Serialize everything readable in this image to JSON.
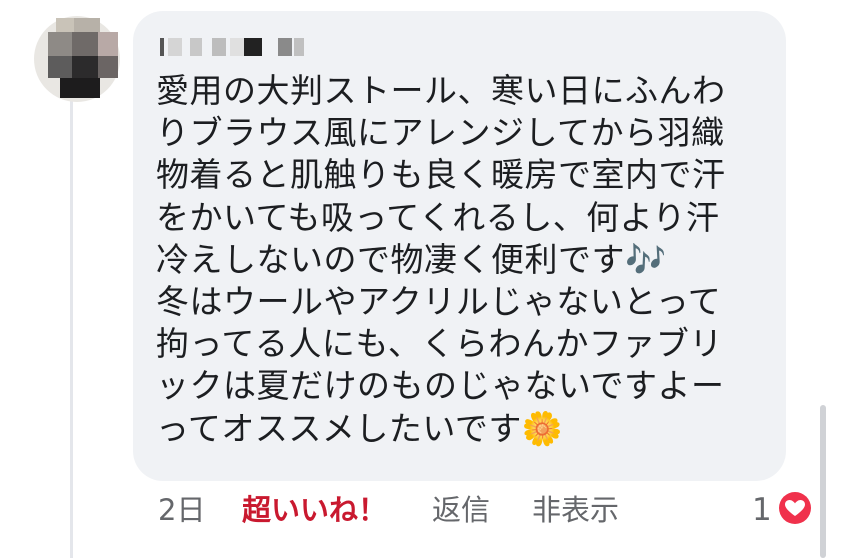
{
  "comment": {
    "lines": [
      "愛用の大判ストール、寒い日にふんわ",
      "りブラウス風にアレンジしてから羽織",
      "物着ると肌触りも良く暖房で室内で汗",
      "をかいても吸ってくれるし、何より汗",
      "冷えしないので物凄く便利です🎶",
      "冬はウールやアクリルじゃないとって",
      "拘ってる人にも、くらわんかファブリ",
      "ックは夏だけのものじゃないですよー",
      "ってオススメしたいです🌼"
    ]
  },
  "actions": {
    "time": "2日",
    "like_label": "超いいね！",
    "reply_label": "返信",
    "hide_label": "非表示",
    "reaction_count": "1"
  },
  "icons": {
    "music": "musical-notes-icon",
    "flower": "sunflower-icon",
    "reaction": "love-heart-icon"
  },
  "colors": {
    "bubble": "#f0f2f5",
    "text": "#1c1e21",
    "secondary": "#65676b",
    "super_like": "#c9192f",
    "heart": "#f0314c"
  }
}
